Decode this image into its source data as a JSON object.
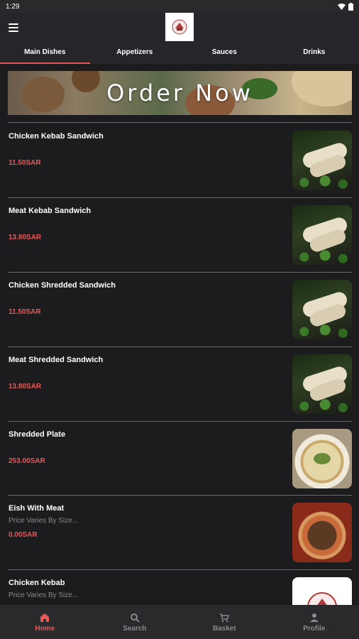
{
  "status_bar": {
    "time": "1:29"
  },
  "tabs": [
    {
      "label": "Main Dishes",
      "active": true
    },
    {
      "label": "Appetizers"
    },
    {
      "label": "Sauces"
    },
    {
      "label": "Drinks"
    }
  ],
  "banner": {
    "text": "Order Now"
  },
  "menu_items": [
    {
      "name": "Chicken Kebab Sandwich",
      "price": "11.50SAR",
      "image": "wrap-sandwich"
    },
    {
      "name": "Meat Kebab Sandwich",
      "price": "13.80SAR",
      "image": "wrap-sandwich"
    },
    {
      "name": "Chicken Shredded Sandwich",
      "price": "11.50SAR",
      "image": "wrap-sandwich"
    },
    {
      "name": "Meat Shredded Sandwich",
      "price": "13.80SAR",
      "image": "wrap-sandwich"
    },
    {
      "name": "Shredded Plate",
      "price": "253.00SAR",
      "image": "plate"
    },
    {
      "name": "Eish With Meat",
      "description": "Price Varies By Size...",
      "price": "0.00SAR",
      "image": "flatbread"
    },
    {
      "name": "Chicken Kebab",
      "description": "Price Varies By Size...",
      "price": "",
      "image": "logo"
    }
  ],
  "bottom_nav": [
    {
      "label": "Home",
      "icon": "home-icon",
      "active": true
    },
    {
      "label": "Search",
      "icon": "search-icon"
    },
    {
      "label": "Basket",
      "icon": "cart-icon"
    },
    {
      "label": "Profile",
      "icon": "person-icon"
    }
  ],
  "colors": {
    "accent": "#e85a5a",
    "background": "#1c1c1e",
    "bar": "#26262a"
  }
}
